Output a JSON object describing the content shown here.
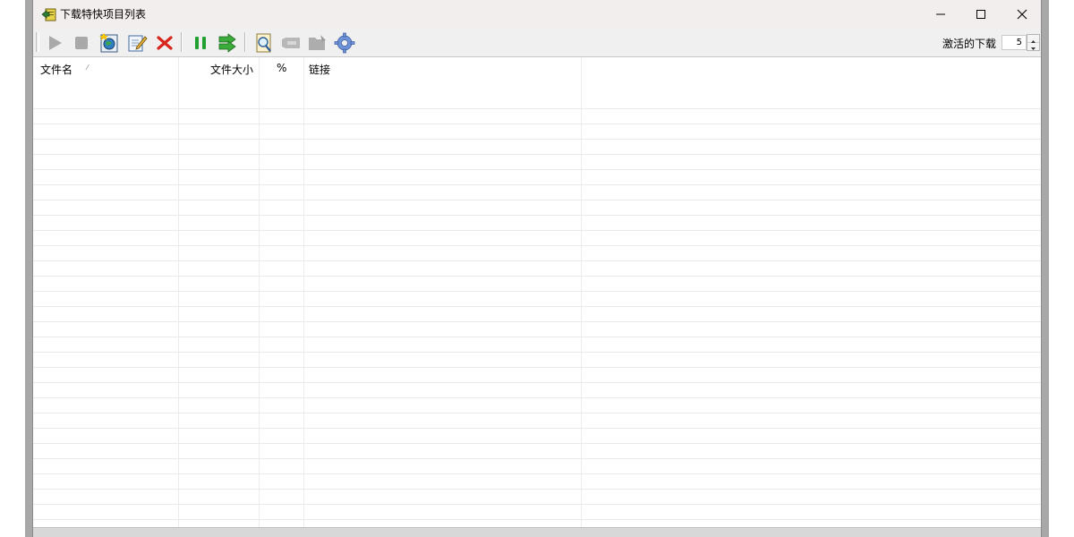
{
  "window": {
    "title": "下载特快项目列表"
  },
  "toolbar": {
    "buttons": [
      {
        "name": "start",
        "icon": "play-icon"
      },
      {
        "name": "stop",
        "icon": "stop-icon"
      },
      {
        "name": "add-download",
        "icon": "globe-add-icon"
      },
      {
        "name": "edit",
        "icon": "edit-icon"
      },
      {
        "name": "delete",
        "icon": "delete-x-icon"
      },
      {
        "name": "pause-all",
        "icon": "pause-icon"
      },
      {
        "name": "move",
        "icon": "forward-arrow-icon"
      },
      {
        "name": "find",
        "icon": "search-document-icon"
      },
      {
        "name": "tag",
        "icon": "tag-icon"
      },
      {
        "name": "open-folder",
        "icon": "folder-icon"
      },
      {
        "name": "settings",
        "icon": "gear-icon"
      }
    ],
    "active_label": "激活的下载",
    "active_value": "5"
  },
  "table": {
    "columns": [
      "文件名",
      "文件大小",
      "%",
      "链接"
    ],
    "sort_indicator": "⁄"
  },
  "colors": {
    "title_bg": "#f3eeee",
    "toolbar_bg": "#f0f0f0",
    "grid_line": "#e9e9e9"
  }
}
